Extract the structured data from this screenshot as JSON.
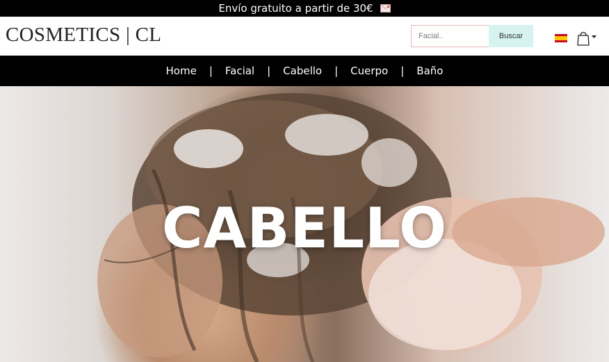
{
  "topbar": {
    "text": "Envío gratuito a partir de 30€",
    "icon": "envelope-icon"
  },
  "header": {
    "logo": "COSMETICS | CL",
    "search": {
      "placeholder": "Facial..",
      "value": "",
      "button_label": "Buscar"
    },
    "language_flag": "spain-flag-icon",
    "cart_icon": "shopping-bag-icon"
  },
  "nav": {
    "items": [
      {
        "label": "Home"
      },
      {
        "label": "Facial"
      },
      {
        "label": "Cabello"
      },
      {
        "label": "Cuerpo"
      },
      {
        "label": "Baño"
      }
    ],
    "separator": "|"
  },
  "hero": {
    "title": "CABELLO"
  },
  "colors": {
    "topbar_bg": "#000000",
    "nav_bg": "#000000",
    "search_button_bg": "#d6f3ef",
    "search_border": "#e8b4b4",
    "flag_red": "#c60b1e",
    "flag_yellow": "#ffc400"
  }
}
